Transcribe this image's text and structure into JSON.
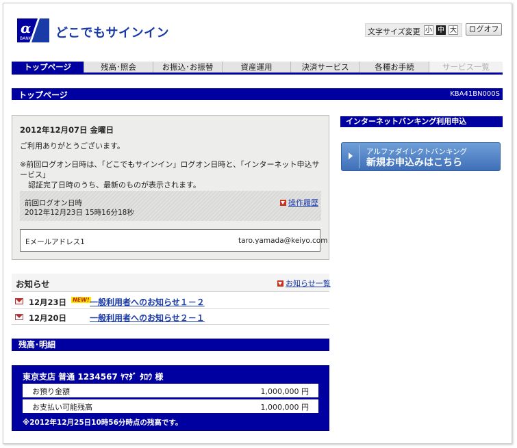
{
  "header": {
    "logo_text": "BANK",
    "app_title": "どこでもサインイン",
    "font_size_label": "文字サイズ変更",
    "font_sizes": [
      "小",
      "中",
      "大"
    ],
    "font_size_selected": "中",
    "logoff_label": "ログオフ"
  },
  "nav": {
    "items": [
      {
        "label": "トップページ",
        "state": "active"
      },
      {
        "label": "残高･照会",
        "state": "normal"
      },
      {
        "label": "お振込･お振替",
        "state": "normal"
      },
      {
        "label": "資産運用",
        "state": "normal"
      },
      {
        "label": "決済サービス",
        "state": "normal"
      },
      {
        "label": "各種お手続",
        "state": "normal"
      },
      {
        "label": "サービス一覧",
        "state": "disabled"
      }
    ]
  },
  "page": {
    "title": "トップページ",
    "code": "KBA41BN000S"
  },
  "welcome": {
    "date": "2012年12月07日 金曜日",
    "thanks": "ご利用ありがとうございます。",
    "note_line1": "※前回ログオン日時は、「どこでもサインイン」ログオン日時と、「インターネット申込サービス」",
    "note_line2": "認証完了日時のうち、最新のものが表示されます。",
    "last_login_label": "前回ログオン日時",
    "last_login_value": "2012年12月23日 15時16分18秒",
    "history_link": "操作履歴",
    "email_label": "Eメールアドレス1",
    "email_value": "taro.yamada@keiyo.com"
  },
  "sidebar": {
    "internet_banking_label": "インターネットバンキング利用申込",
    "promo_line1": "アルファダイレクトバンキング",
    "promo_line2": "新規お申込みはこちら"
  },
  "notices": {
    "title": "お知らせ",
    "all_link": "お知らせ一覧",
    "items": [
      {
        "date": "12月23日",
        "badge": "NEW!",
        "title": "一般利用者へのお知らせ１－２",
        "read": false
      },
      {
        "date": "12月20日",
        "badge": "",
        "title": "一般利用者へのお知らせ２－１",
        "read": true
      }
    ]
  },
  "balance": {
    "title": "残高･明細",
    "account": "東京支店 普通 1234567 ﾔﾏﾀﾞ ﾀﾛｳ 様",
    "rows": [
      {
        "label": "お預り金額",
        "value": "1,000,000 円"
      },
      {
        "label": "お支払い可能残高",
        "value": "1,000,000 円"
      }
    ],
    "note": "※2012年12月25日10時56分時点の残高です。"
  }
}
